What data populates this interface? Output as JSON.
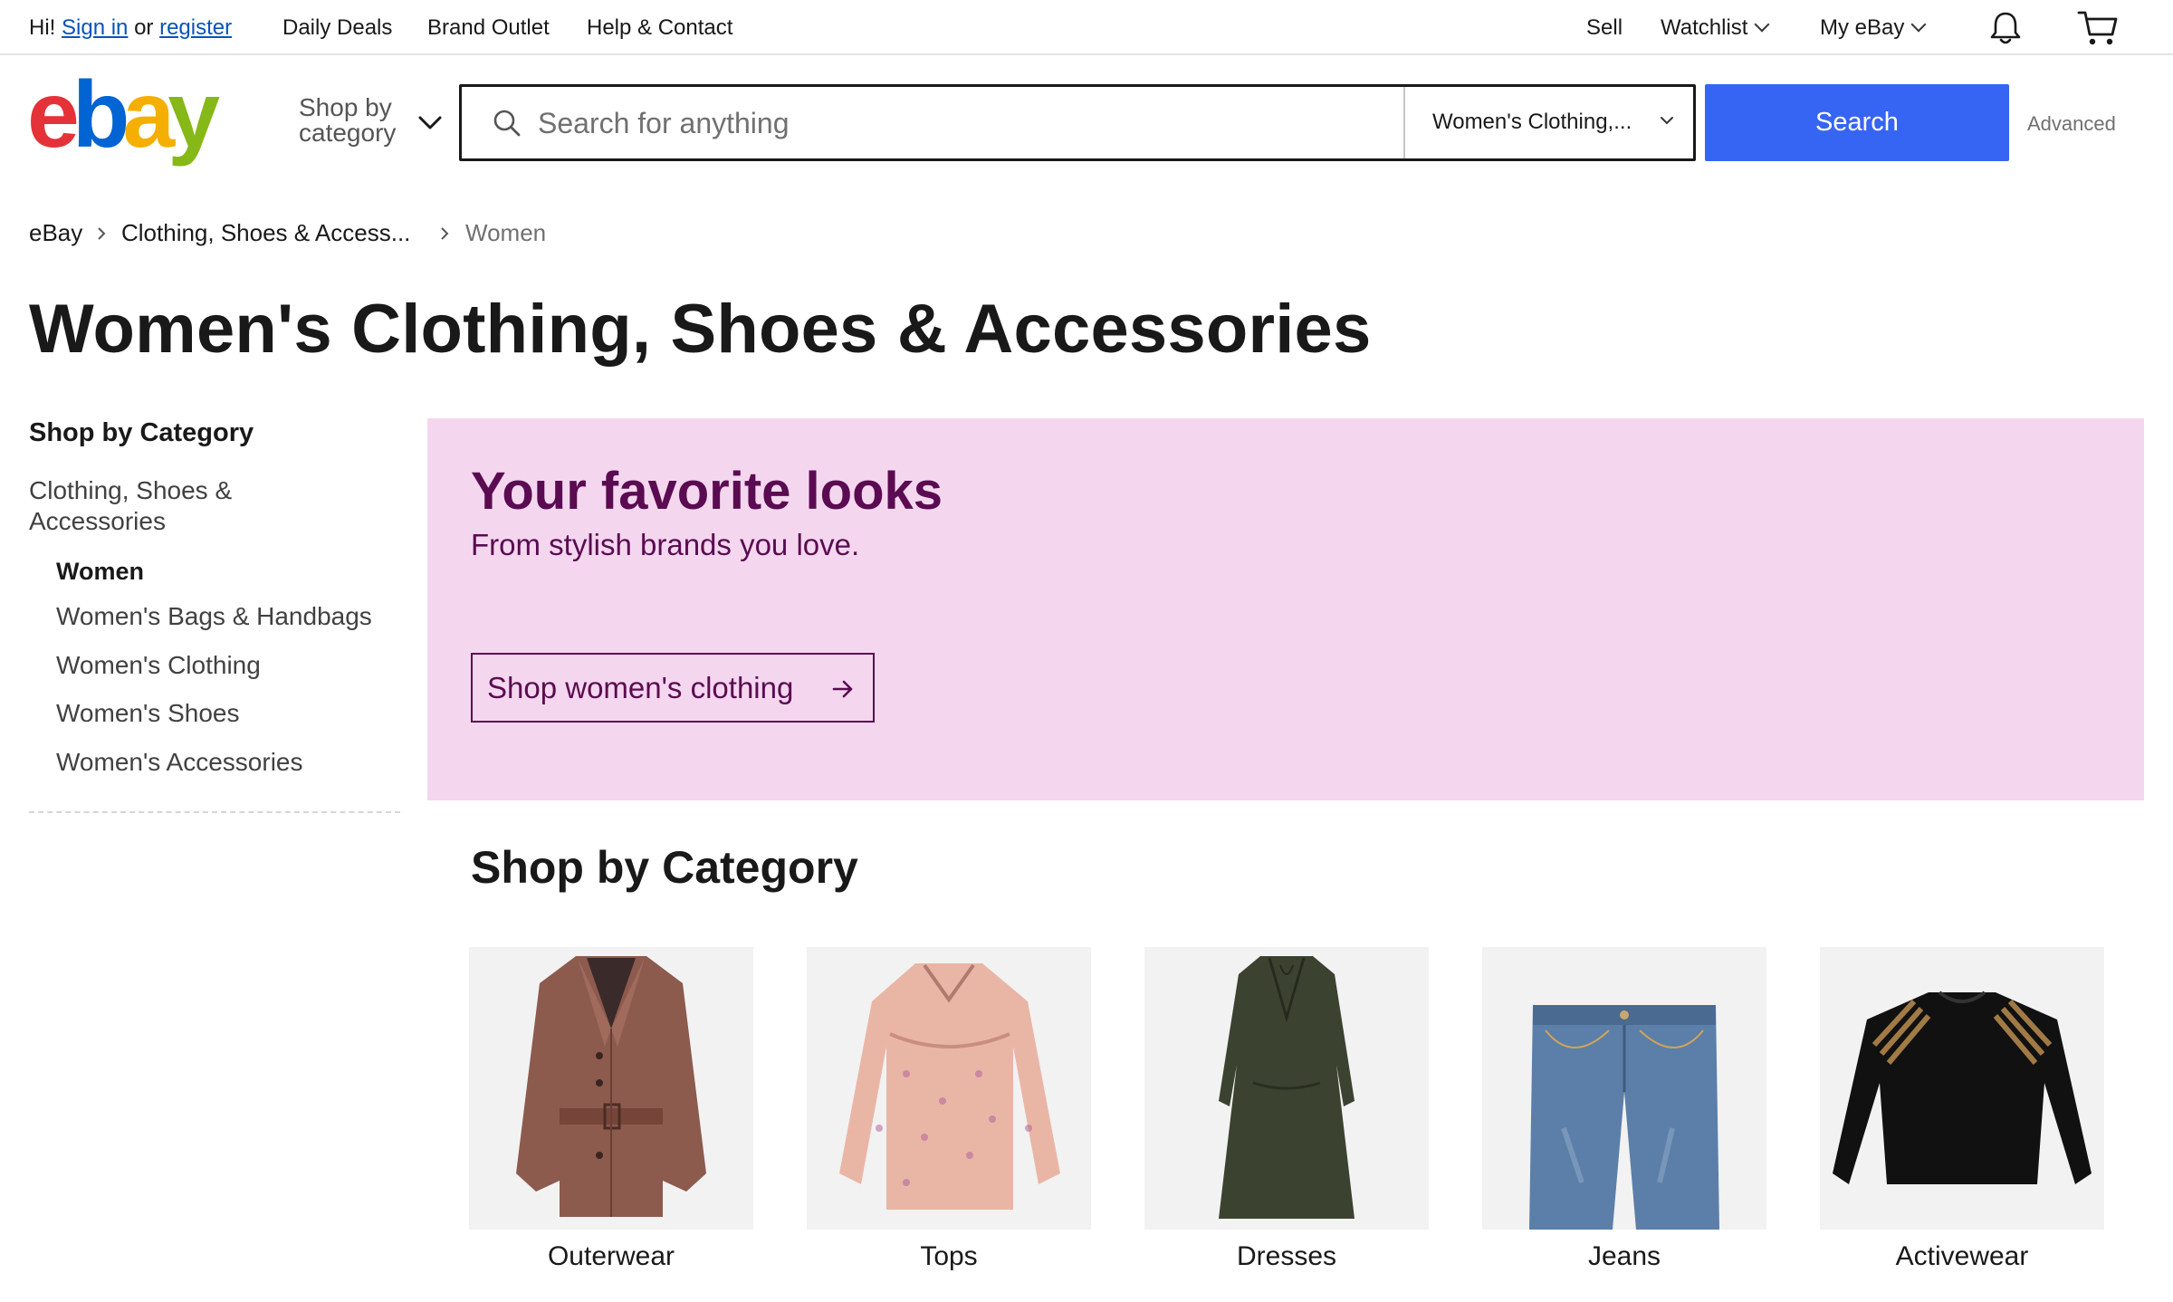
{
  "topbar": {
    "greeting": "Hi!",
    "sign_in": "Sign in",
    "or": "or",
    "register": "register",
    "links": [
      "Daily Deals",
      "Brand Outlet",
      "Help & Contact"
    ],
    "sell": "Sell",
    "watchlist": "Watchlist",
    "my_ebay": "My eBay",
    "icons": [
      "bell-icon",
      "cart-icon"
    ]
  },
  "header": {
    "logo_text": "ebay",
    "logo_colors": [
      "#e53238",
      "#0064d2",
      "#f5af02",
      "#86b817"
    ],
    "shop_by_line1": "Shop by",
    "shop_by_line2": "category",
    "search_placeholder": "Search for anything",
    "search_value": "",
    "category_select": "Women's Clothing,...",
    "search_button": "Search",
    "advanced": "Advanced"
  },
  "breadcrumb": [
    "eBay",
    "Clothing, Shoes & Access...",
    "Women"
  ],
  "page_title": "Women's Clothing, Shoes & Accessories",
  "sidebar": {
    "heading": "Shop by Category",
    "root": "Clothing, Shoes & Accessories",
    "selected": "Women",
    "items": [
      "Women's Bags & Handbags",
      "Women's Clothing",
      "Women's Shoes",
      "Women's Accessories"
    ]
  },
  "banner": {
    "title": "Your favorite looks",
    "subtitle": "From stylish brands you love.",
    "button": "Shop women's clothing",
    "bg_color": "#f4d7ef",
    "text_color": "#5b0b51"
  },
  "shop_by_category": {
    "heading": "Shop by Category",
    "cards": [
      {
        "label": "Outerwear"
      },
      {
        "label": "Tops"
      },
      {
        "label": "Dresses"
      },
      {
        "label": "Jeans"
      },
      {
        "label": "Activewear"
      }
    ]
  },
  "colors": {
    "accent": "#3665f3",
    "link": "#0654ba",
    "text": "#191919"
  }
}
